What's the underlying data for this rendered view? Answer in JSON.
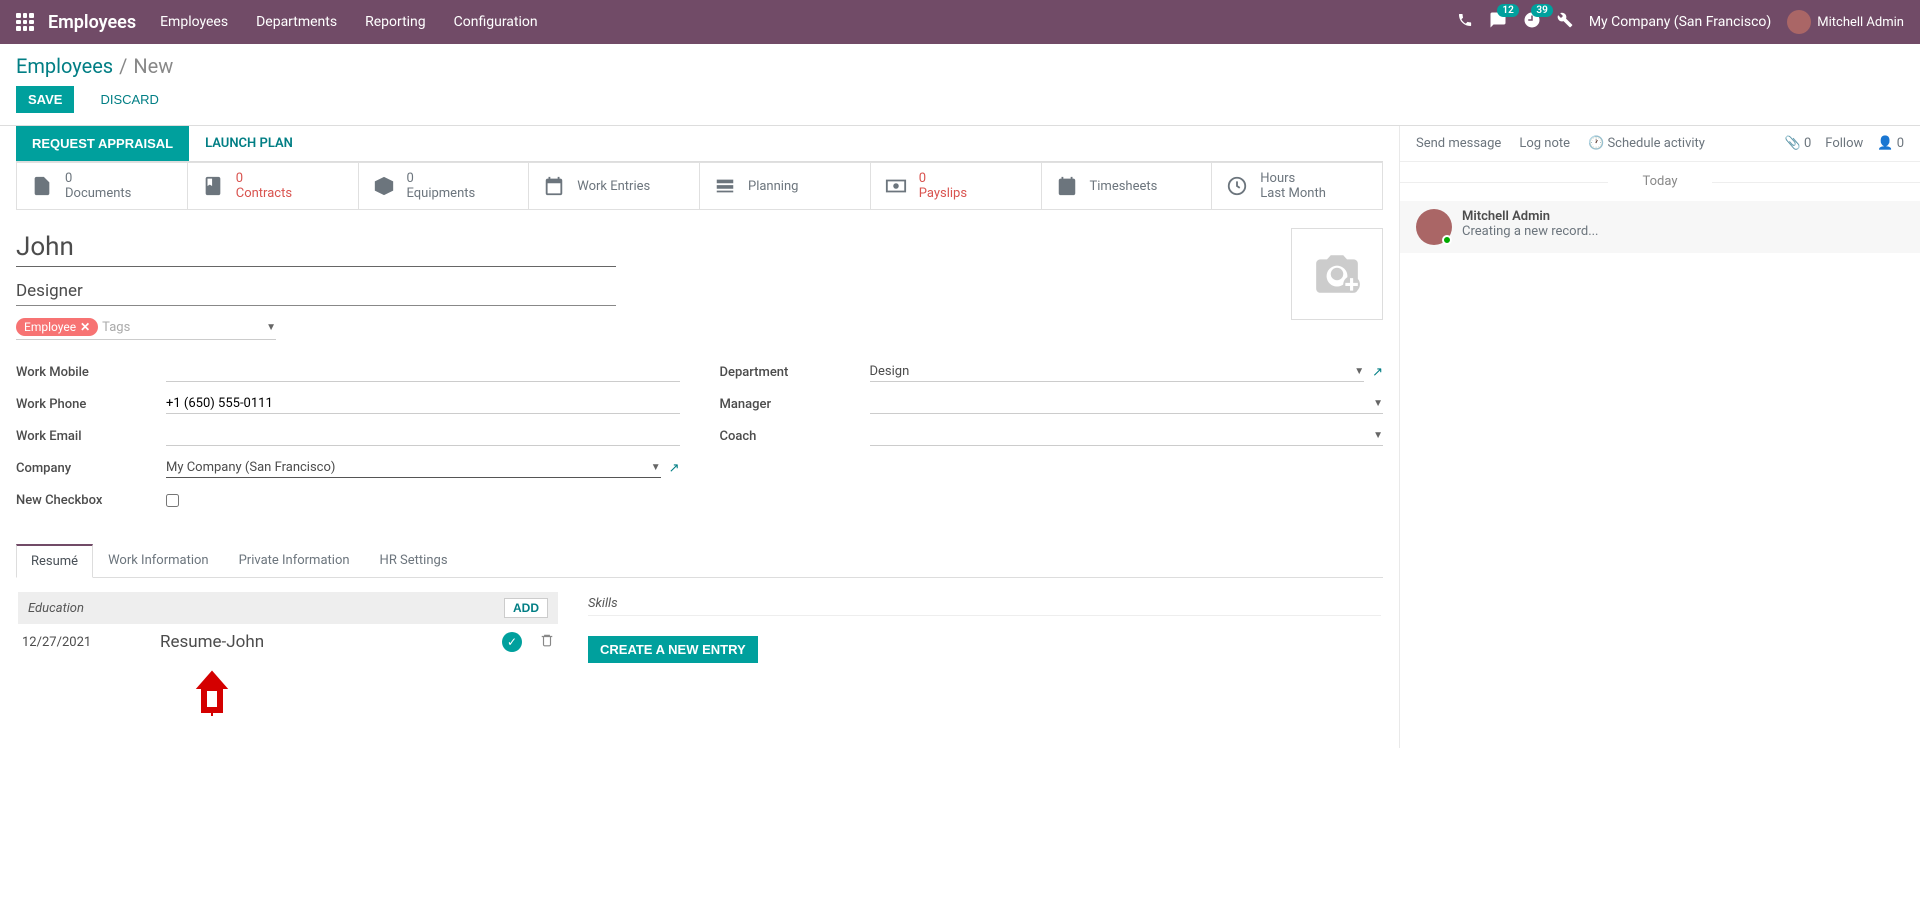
{
  "topnav": {
    "brand": "Employees",
    "menu": [
      "Employees",
      "Departments",
      "Reporting",
      "Configuration"
    ],
    "msg_badge": "12",
    "clock_badge": "39",
    "company": "My Company (San Francisco)",
    "user": "Mitchell Admin"
  },
  "breadcrumb": {
    "root": "Employees",
    "current": "New"
  },
  "actions": {
    "save": "SAVE",
    "discard": "DISCARD"
  },
  "status": {
    "request": "REQUEST APPRAISAL",
    "launch": "LAUNCH PLAN"
  },
  "stats": [
    {
      "num": "0",
      "label": "Documents",
      "red": false
    },
    {
      "num": "0",
      "label": "Contracts",
      "red": true
    },
    {
      "num": "0",
      "label": "Equipments",
      "red": false
    },
    {
      "num": "",
      "label": "Work Entries",
      "red": false
    },
    {
      "num": "",
      "label": "Planning",
      "red": false
    },
    {
      "num": "0",
      "label": "Payslips",
      "red": true
    },
    {
      "num": "",
      "label": "Timesheets",
      "red": false
    },
    {
      "num": "Hours",
      "label": "Last Month",
      "red": false
    }
  ],
  "employee": {
    "name": "John",
    "jobtitle": "Designer",
    "tag": "Employee",
    "tags_placeholder": "Tags"
  },
  "fields_left": {
    "work_mobile": {
      "label": "Work Mobile",
      "value": ""
    },
    "work_phone": {
      "label": "Work Phone",
      "value": "+1 (650) 555-0111"
    },
    "work_email": {
      "label": "Work Email",
      "value": ""
    },
    "company": {
      "label": "Company",
      "value": "My Company (San Francisco)"
    },
    "new_checkbox": {
      "label": "New Checkbox"
    }
  },
  "fields_right": {
    "department": {
      "label": "Department",
      "value": "Design"
    },
    "manager": {
      "label": "Manager",
      "value": ""
    },
    "coach": {
      "label": "Coach",
      "value": ""
    }
  },
  "tabs": [
    "Resumé",
    "Work Information",
    "Private Information",
    "HR Settings"
  ],
  "resume": {
    "section": "Education",
    "add": "ADD",
    "date": "12/27/2021",
    "title": "Resume-John"
  },
  "skills": {
    "header": "Skills",
    "create": "CREATE A NEW ENTRY"
  },
  "chatter": {
    "send": "Send message",
    "log": "Log note",
    "schedule": "Schedule activity",
    "attach_count": "0",
    "follow": "Follow",
    "follow_count": "0",
    "today": "Today",
    "msg_name": "Mitchell Admin",
    "msg_text": "Creating a new record..."
  }
}
